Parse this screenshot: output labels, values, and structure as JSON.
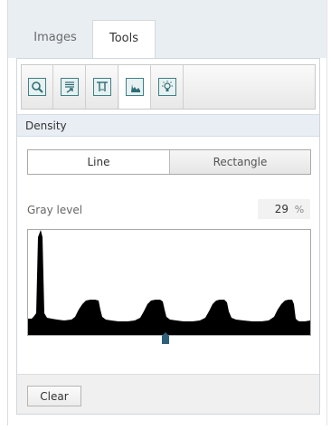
{
  "tabs": [
    {
      "label": "Images",
      "active": false
    },
    {
      "label": "Tools",
      "active": true
    }
  ],
  "toolbar": {
    "buttons": [
      {
        "icon": "zoom-region-icon",
        "active": false
      },
      {
        "icon": "transfer-list-icon",
        "active": false
      },
      {
        "icon": "measure-calipers-icon",
        "active": false
      },
      {
        "icon": "density-histogram-icon",
        "active": true
      },
      {
        "icon": "lightbulb-icon",
        "active": false
      }
    ]
  },
  "section": {
    "title": "Density"
  },
  "mode": {
    "options": [
      "Line",
      "Rectangle"
    ],
    "selected": "Line"
  },
  "gray_level": {
    "label": "Gray level",
    "value": "29",
    "unit": "%"
  },
  "density_plot": {
    "handle_position_fraction": 0.49
  },
  "actions": {
    "clear_label": "Clear"
  },
  "colors": {
    "accent": "#3f7f86",
    "plot_fill": "#000000",
    "header_bg": "#e8eef4",
    "tabstrip_bg": "#e9eef3"
  }
}
